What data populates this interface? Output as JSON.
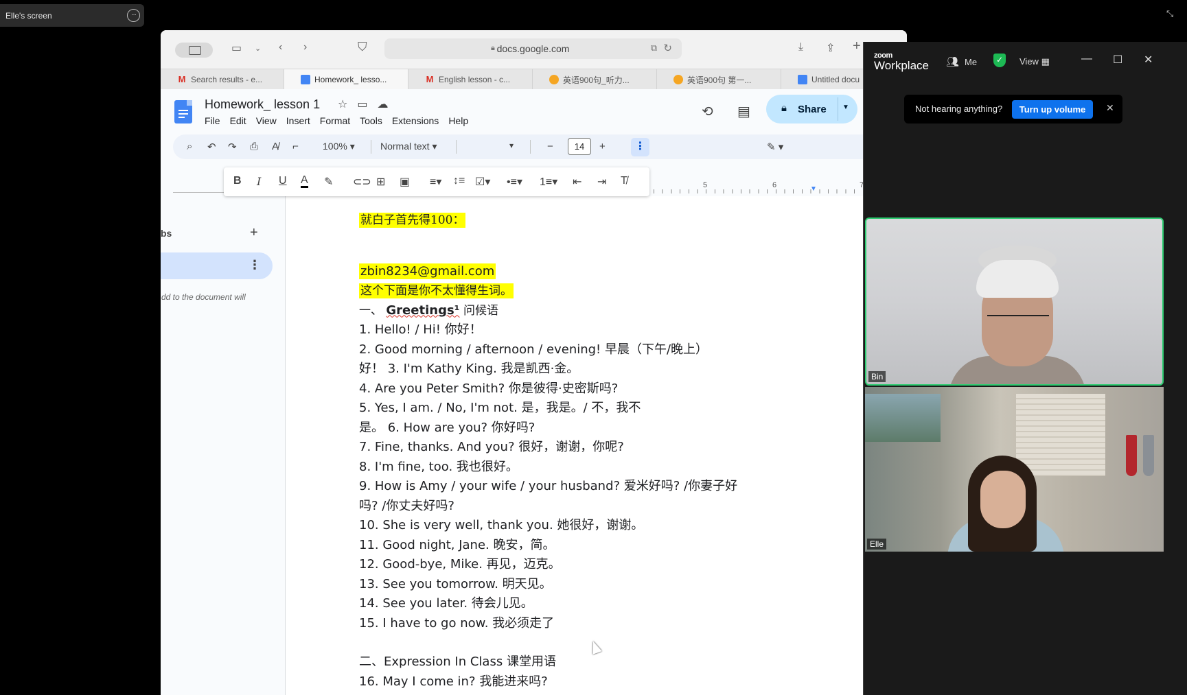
{
  "zoom_share": {
    "label": "Elle's screen"
  },
  "browser": {
    "url": "docs.google.com",
    "tabs": [
      {
        "label": "Search results - e...",
        "icon": "gmail-icon"
      },
      {
        "label": "Homework_ lesso...",
        "icon": "docs-icon",
        "active": true
      },
      {
        "label": "English lesson - c...",
        "icon": "gmail-icon"
      },
      {
        "label": "英语900句_听力...",
        "icon": "site-icon"
      },
      {
        "label": "英语900句 第一...",
        "icon": "site-icon"
      },
      {
        "label": "Untitled docu",
        "icon": "docs-icon"
      }
    ]
  },
  "docs": {
    "title": "Homework_ lesson 1",
    "menu": [
      "File",
      "Edit",
      "View",
      "Insert",
      "Format",
      "Tools",
      "Extensions",
      "Help"
    ],
    "share_label": "Share",
    "zoom": "100%",
    "style": "Normal text",
    "font_size": "14",
    "ruler_marks": [
      "5",
      "6",
      "7"
    ],
    "sidebar": {
      "tabs_label": "bs",
      "hint": "dd to the document will"
    },
    "content": {
      "line_0": "就白子首先得100：",
      "line_1": "zbin8234@gmail.com",
      "line_2": "这个下面是你不太懂得生词。",
      "line_3a": "一、",
      "line_3b": "Greetings¹",
      "line_3c": " 问候语",
      "lines": [
        "1. Hello! / Hi! 你好！",
        "2. Good morning / afternoon / evening! 早晨（下午/晚上）",
        "好！ 3. I'm Kathy King. 我是凯西·金。",
        "4. Are you Peter Smith? 你是彼得·史密斯吗?",
        "5. Yes, I am. / No, I'm not. 是，我是。/ 不，我不",
        "是。 6. How are you? 你好吗?",
        "7. Fine, thanks. And you? 很好，谢谢，你呢?",
        "8. I'm fine, too. 我也很好。",
        "9. How is Amy / your wife / your husband? 爱米好吗? /你妻子好",
        "吗? /你丈夫好吗?",
        "10. She is very well, thank you. 她很好，谢谢。",
        "11. Good night, Jane. 晚安，简。",
        "12. Good-bye, Mike. 再见，迈克。",
        "13. See you tomorrow. 明天见。",
        "14. See you later. 待会儿见。",
        "15. I have to go now. 我必须走了",
        "",
        "二、Expression In Class 课堂用语",
        "16. May I come in? 我能进来吗?"
      ]
    }
  },
  "zoom": {
    "logo_small": "zoom",
    "logo_large": "Workplace",
    "me_label": "Me",
    "view_label": "View",
    "toast_message": "Not hearing anything?",
    "toast_button": "Turn up volume",
    "participants": [
      {
        "name": "Bin"
      },
      {
        "name": "Elle"
      }
    ]
  },
  "colors": {
    "highlight": "#ffff00",
    "share_button": "#c2e7ff",
    "zoom_accent": "#0e72ed",
    "active_speaker": "#2ecc71"
  }
}
